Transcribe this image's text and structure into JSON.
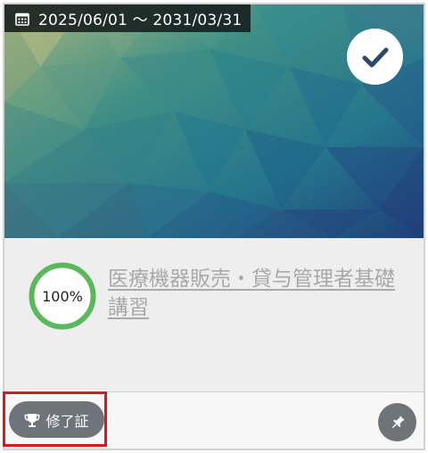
{
  "card": {
    "period": "2025/06/01 ～ 2031/03/31",
    "icons": {
      "calendar": "calendar-icon",
      "completed": "check-icon",
      "certificate": "trophy-icon",
      "pin": "pin-icon"
    },
    "progress": {
      "value": 100,
      "label": "100%"
    },
    "course_title": "医療機器販売・貸与管理者基礎講習",
    "certificate_button_label": "修了証"
  },
  "colors": {
    "progress": "#5cb85c",
    "title_link": "#a9a9a9",
    "button_bg": "#6e747a",
    "highlight": "#e0141b",
    "check": "#2b4a6b"
  }
}
